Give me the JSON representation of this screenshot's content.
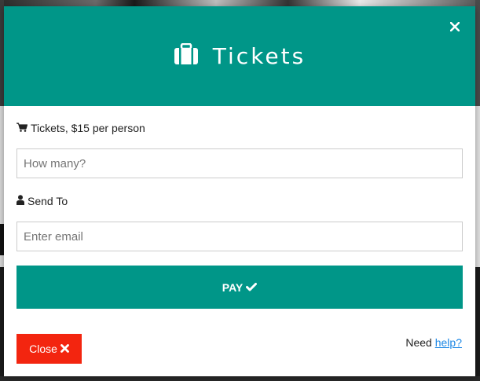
{
  "modal": {
    "header": {
      "title": "Tickets",
      "icon": "briefcase-icon",
      "close_icon": "close-icon"
    },
    "body": {
      "tickets_label": "Tickets, $15 per person",
      "tickets_icon": "shopping-cart-icon",
      "quantity_placeholder": "How many?",
      "send_to_label": "Send To",
      "send_to_icon": "user-icon",
      "email_placeholder": "Enter email",
      "pay_label": "PAY",
      "pay_icon": "checkmark-icon"
    },
    "footer": {
      "close_label": "Close",
      "close_icon": "x-icon",
      "need_text": "Need",
      "help_link": "help?"
    }
  },
  "colors": {
    "accent": "#009688",
    "danger": "#f3250f",
    "link": "#1e88e5"
  }
}
